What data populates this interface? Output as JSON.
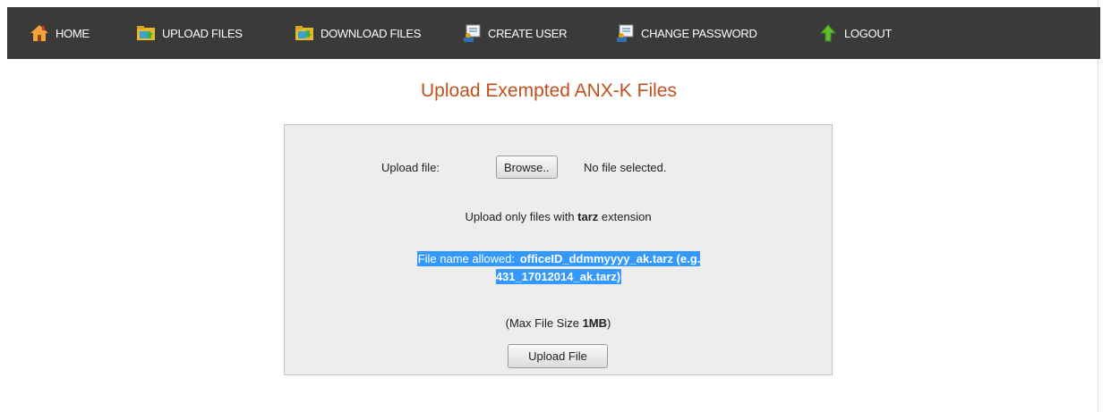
{
  "nav": {
    "items": [
      {
        "label": "HOME",
        "icon": "home-icon"
      },
      {
        "label": "UPLOAD FILES",
        "icon": "upload-folder-icon"
      },
      {
        "label": "DOWNLOAD FILES",
        "icon": "download-folder-icon"
      },
      {
        "label": "CREATE USER",
        "icon": "user-card-icon"
      },
      {
        "label": "CHANGE PASSWORD",
        "icon": "password-card-icon"
      },
      {
        "label": "LOGOUT",
        "icon": "up-arrow-icon"
      }
    ]
  },
  "page": {
    "title": "Upload Exempted ANX-K Files"
  },
  "upload_form": {
    "file_label": "Upload file:",
    "browse_label": "Browse..",
    "file_status": "No file selected.",
    "ext_note_prefix": "Upload only files with ",
    "ext_note_ext": "tarz",
    "ext_note_suffix": " extension",
    "name_note_prefix": "File name allowed: ",
    "name_note_pattern": "officeID_ddmmyyyy_ak.tarz (e.g. 431_17012014_ak.tarz)",
    "size_note_prefix": "(Max File Size ",
    "size_note_value": "1MB",
    "size_note_suffix": ")",
    "upload_label": "Upload File"
  },
  "colors": {
    "nav_background": "#3a3a3a",
    "title": "#c2501e",
    "panel_background": "#ededed",
    "selection_highlight": "#3399ff"
  }
}
